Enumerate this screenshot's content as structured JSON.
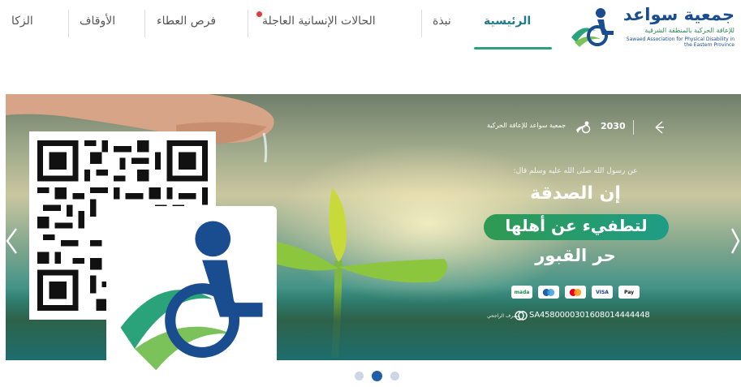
{
  "header": {
    "logo": {
      "name": "جمعية سواعد",
      "subtitle": "للإعاقة الحركية بالمنطقة الشرقية",
      "english": "Sawaed Association for Physical Disability in the Eastern Province"
    },
    "nav": [
      {
        "label": "الرئيسية",
        "active": true
      },
      {
        "label": "نبذة",
        "active": false
      },
      {
        "label": "الحالات الإنسانية العاجلة",
        "active": false,
        "badge": true
      },
      {
        "label": "فرص العطاء",
        "active": false
      },
      {
        "label": "الأوقاف",
        "active": false
      },
      {
        "label": "الزكا",
        "active": false
      }
    ]
  },
  "banner": {
    "brand_text": "جمعية سواعد للإعاقة الحركية",
    "vision_text": "2030",
    "hadith": "عن رسول الله صلى الله عليه وسلم قال:",
    "title_line1": "إن الصدقة",
    "title_line2": "لتطفيء عن أهلها",
    "title_line3": "حر القبور",
    "payment_methods": [
      "mada",
      "mastercard-dots",
      "mastercard",
      "VISA",
      "Pay"
    ],
    "iban": "SA4580000301608014444448",
    "bank_text": "مصرف الراجحي",
    "prev_icon": "chevron-left-icon",
    "next_icon": "chevron-right-icon"
  },
  "pagination": {
    "count": 3,
    "active_index": 1
  },
  "colors": {
    "brand_blue": "#1a4d8f",
    "brand_green": "#2aa37a",
    "nav_active": "#1f7a8c",
    "urgent_dot": "#e03a3a",
    "dot_active": "#1f5fa8",
    "dot_inactive": "#ccd6e6"
  }
}
